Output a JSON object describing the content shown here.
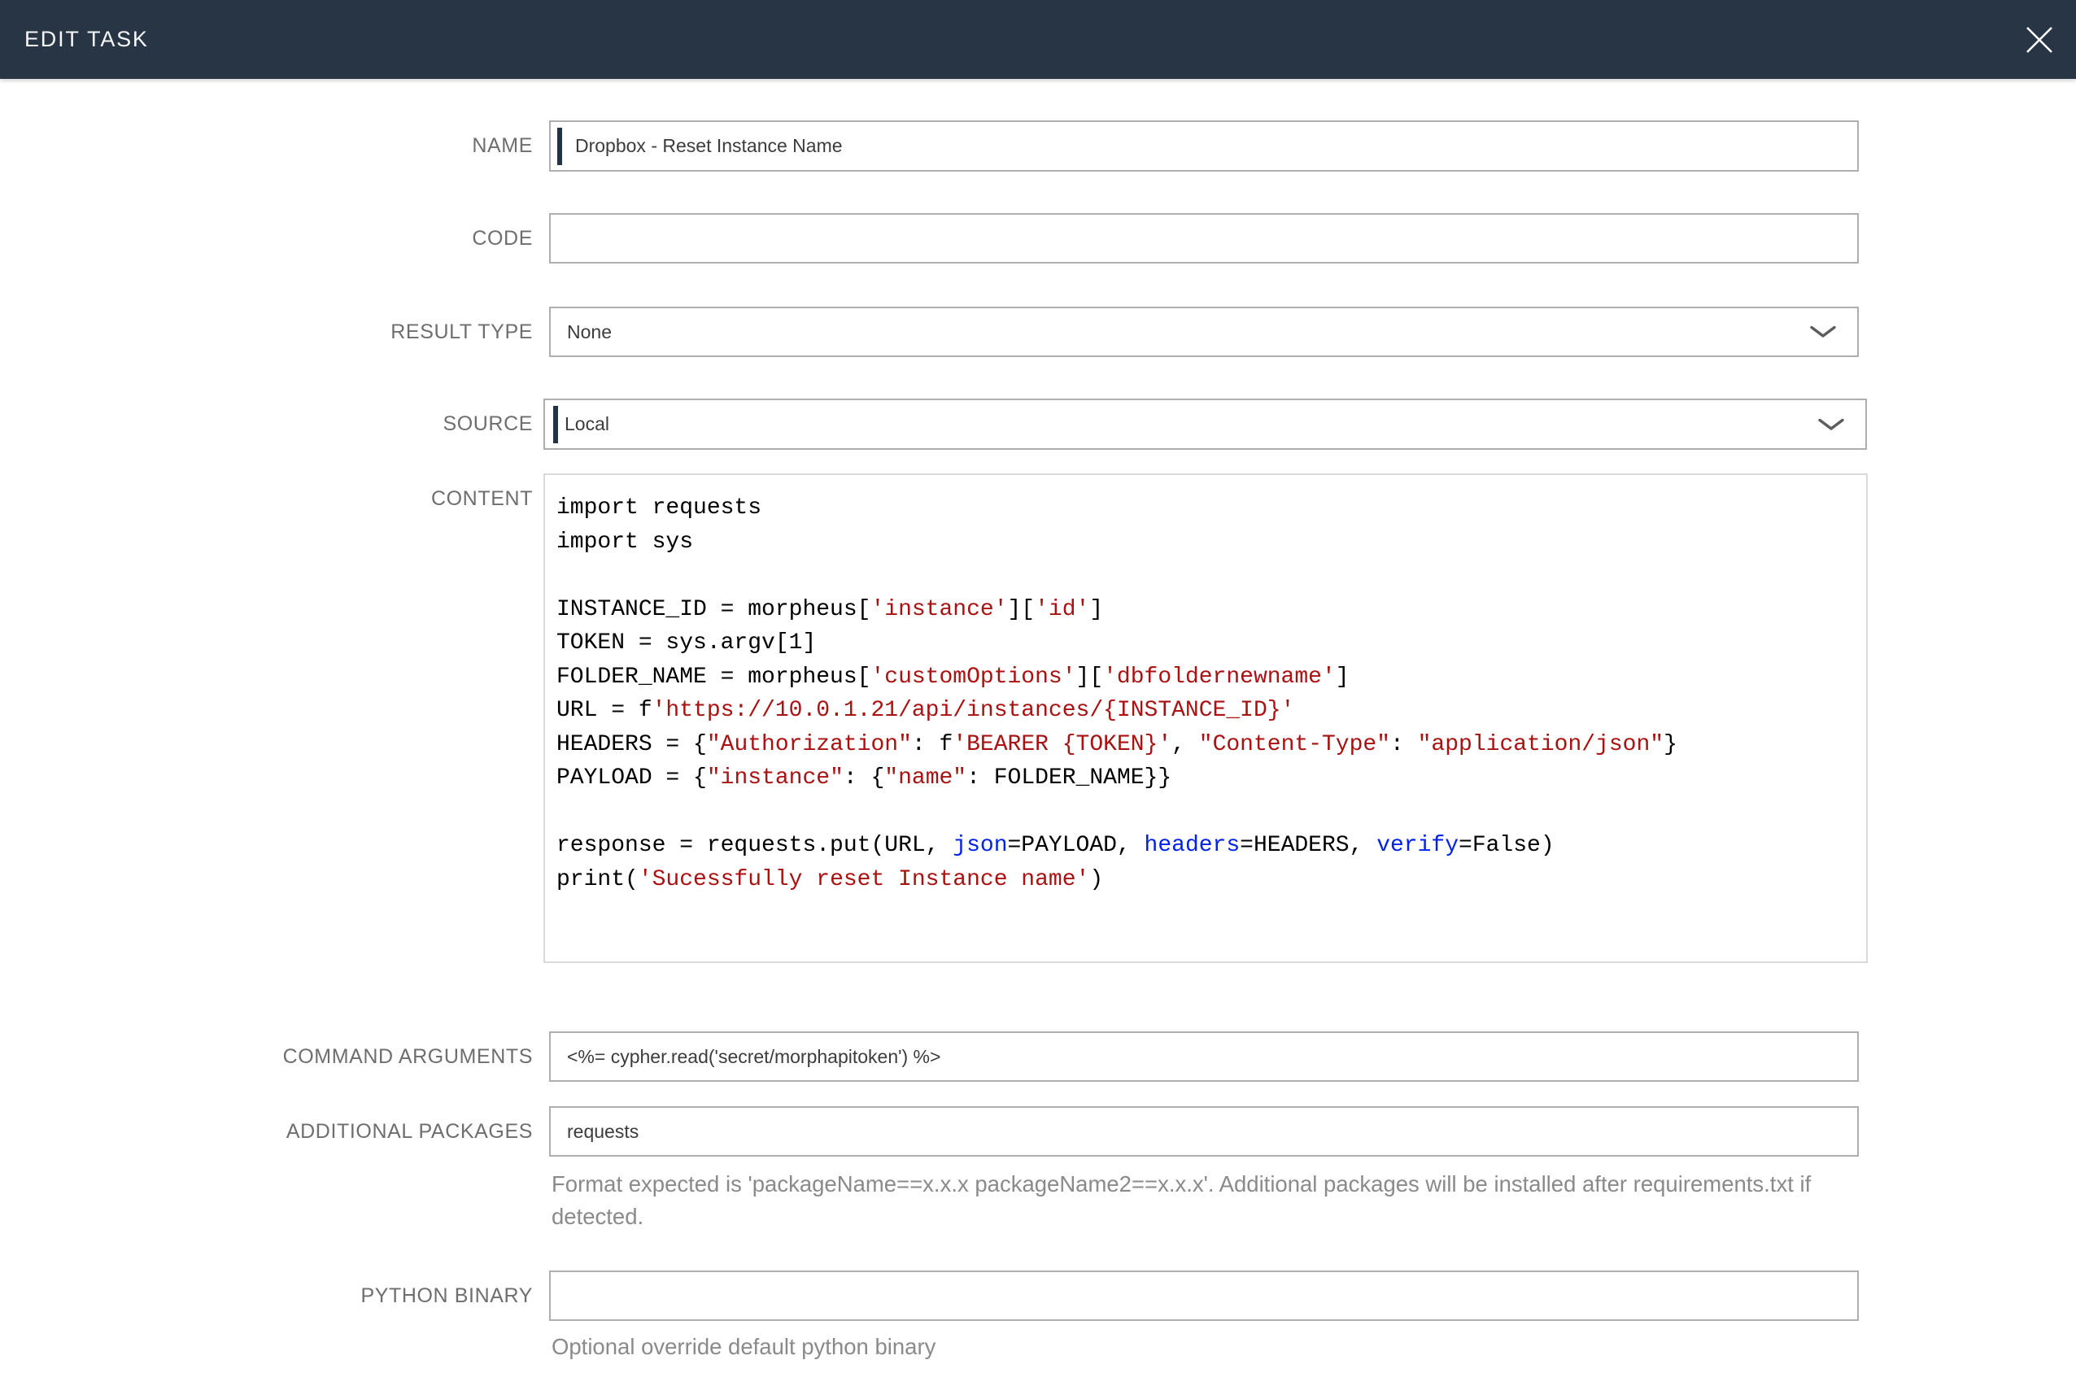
{
  "header": {
    "title": "EDIT TASK",
    "close_icon": "x-icon",
    "bg_color": "#273545"
  },
  "fields": {
    "name": {
      "label": "NAME",
      "value": "Dropbox - Reset Instance Name"
    },
    "code": {
      "label": "CODE",
      "value": ""
    },
    "result_type": {
      "label": "RESULT TYPE",
      "value": "None"
    },
    "source": {
      "label": "SOURCE",
      "value": "Local"
    },
    "content": {
      "label": "CONTENT"
    },
    "command_arguments": {
      "label": "COMMAND ARGUMENTS",
      "value": "<%= cypher.read('secret/morphapitoken') %>"
    },
    "additional_packages": {
      "label": "ADDITIONAL PACKAGES",
      "value": "requests",
      "help": "Format expected is 'packageName==x.x.x packageName2==x.x.x'. Additional packages will be installed after requirements.txt if detected."
    },
    "python_binary": {
      "label": "PYTHON BINARY",
      "value": "",
      "help": "Optional override default python binary"
    }
  },
  "code_editor": {
    "language": "python",
    "token_colors": {
      "p": "#000000",
      "s": "#aa1111",
      "b": "#0022ee"
    },
    "lines": [
      [
        {
          "t": "import requests",
          "c": "p"
        }
      ],
      [
        {
          "t": "import sys",
          "c": "p"
        }
      ],
      [],
      [
        {
          "t": "INSTANCE_ID = morpheus[",
          "c": "p"
        },
        {
          "t": "'instance'",
          "c": "s"
        },
        {
          "t": "][",
          "c": "p"
        },
        {
          "t": "'id'",
          "c": "s"
        },
        {
          "t": "]",
          "c": "p"
        }
      ],
      [
        {
          "t": "TOKEN = sys.argv[1]",
          "c": "p"
        }
      ],
      [
        {
          "t": "FOLDER_NAME = morpheus[",
          "c": "p"
        },
        {
          "t": "'customOptions'",
          "c": "s"
        },
        {
          "t": "][",
          "c": "p"
        },
        {
          "t": "'dbfoldernewname'",
          "c": "s"
        },
        {
          "t": "]",
          "c": "p"
        }
      ],
      [
        {
          "t": "URL = f",
          "c": "p"
        },
        {
          "t": "'https://10.0.1.21/api/instances/{INSTANCE_ID}'",
          "c": "s"
        }
      ],
      [
        {
          "t": "HEADERS = {",
          "c": "p"
        },
        {
          "t": "\"Authorization\"",
          "c": "s"
        },
        {
          "t": ": f",
          "c": "p"
        },
        {
          "t": "'BEARER {TOKEN}'",
          "c": "s"
        },
        {
          "t": ", ",
          "c": "p"
        },
        {
          "t": "\"Content-Type\"",
          "c": "s"
        },
        {
          "t": ": ",
          "c": "p"
        },
        {
          "t": "\"application/json\"",
          "c": "s"
        },
        {
          "t": "}",
          "c": "p"
        }
      ],
      [
        {
          "t": "PAYLOAD = {",
          "c": "p"
        },
        {
          "t": "\"instance\"",
          "c": "s"
        },
        {
          "t": ": {",
          "c": "p"
        },
        {
          "t": "\"name\"",
          "c": "s"
        },
        {
          "t": ": FOLDER_NAME}}",
          "c": "p"
        }
      ],
      [],
      [
        {
          "t": "response = requests.put(URL, ",
          "c": "p"
        },
        {
          "t": "json",
          "c": "b"
        },
        {
          "t": "=PAYLOAD, ",
          "c": "p"
        },
        {
          "t": "headers",
          "c": "b"
        },
        {
          "t": "=HEADERS, ",
          "c": "p"
        },
        {
          "t": "verify",
          "c": "b"
        },
        {
          "t": "=False)",
          "c": "p"
        }
      ],
      [
        {
          "t": "print(",
          "c": "p"
        },
        {
          "t": "'Sucessfully reset Instance name'",
          "c": "s"
        },
        {
          "t": ")",
          "c": "p"
        }
      ]
    ]
  }
}
